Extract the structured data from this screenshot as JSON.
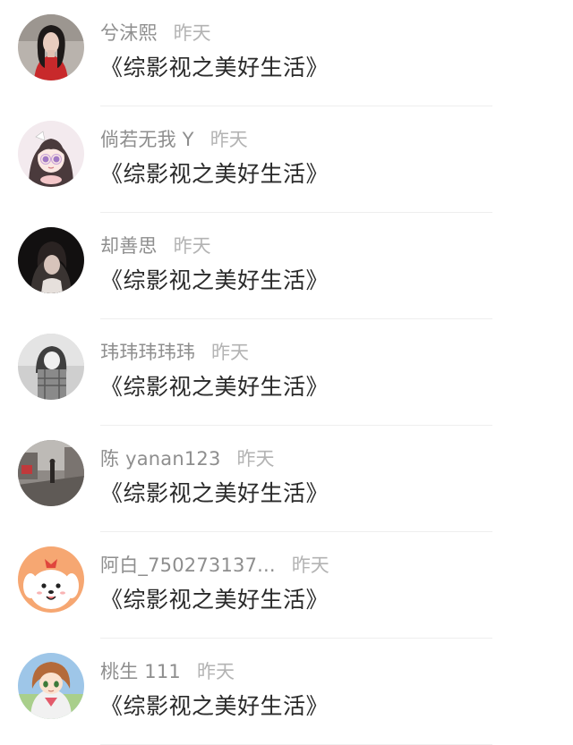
{
  "comments": [
    {
      "name": "兮沫熙",
      "time": "昨天",
      "message": "《综影视之美好生活》",
      "avatar": "avatar-girl-red-top"
    },
    {
      "name": "倘若无我 Y",
      "time": "昨天",
      "message": "《综影视之美好生活》",
      "avatar": "avatar-anime-girl"
    },
    {
      "name": "却善思",
      "time": "昨天",
      "message": "《综影视之美好生活》",
      "avatar": "avatar-dark-portrait"
    },
    {
      "name": "玮玮玮玮玮",
      "time": "昨天",
      "message": "《综影视之美好生活》",
      "avatar": "avatar-grayscale-girl"
    },
    {
      "name": "陈 yanan123",
      "time": "昨天",
      "message": "《综影视之美好生活》",
      "avatar": "avatar-street-photo"
    },
    {
      "name": "阿白_750273137...",
      "time": "昨天",
      "message": "《综影视之美好生活》",
      "avatar": "avatar-cartoon-dog"
    },
    {
      "name": "桃生 111",
      "time": "昨天",
      "message": "《综影视之美好生活》",
      "avatar": "avatar-anime-brown-hair"
    }
  ]
}
